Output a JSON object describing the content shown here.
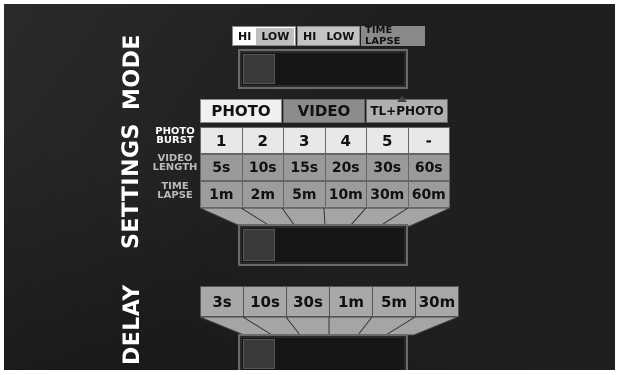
{
  "labels": {
    "mode": "MODE",
    "settings": "SETTINGS",
    "delay": "DELAY"
  },
  "mode_options": {
    "hi_1": "HI",
    "low_1": "LOW",
    "hi_2": "HI",
    "low_2": "LOW",
    "time_lapse": "TIME LAPSE"
  },
  "settings_tabs": [
    "PHOTO",
    "VIDEO",
    "TL+PHOTO"
  ],
  "row_labels": {
    "photo_burst": [
      "PHOTO",
      "BURST"
    ],
    "video_length": [
      "VIDEO",
      "LENGTH"
    ],
    "time_lapse": [
      "TIME",
      "LAPSE"
    ]
  },
  "photo_burst": [
    "1",
    "2",
    "3",
    "4",
    "5",
    "-"
  ],
  "video_length": [
    "5s",
    "10s",
    "15s",
    "20s",
    "30s",
    "60s"
  ],
  "time_lapse": [
    "1m",
    "2m",
    "5m",
    "10m",
    "30m",
    "60m"
  ],
  "delay_options": [
    "3s",
    "10s",
    "30s",
    "1m",
    "5m",
    "30m"
  ],
  "colors": {
    "background": "#1f1f1f",
    "row_photo_burst": "#e8e8e8",
    "row_video_length": "#9a9a9a",
    "row_time_lapse": "#9c9c9c",
    "delay_cells": "#a8a8a8",
    "screen": "#161616"
  }
}
